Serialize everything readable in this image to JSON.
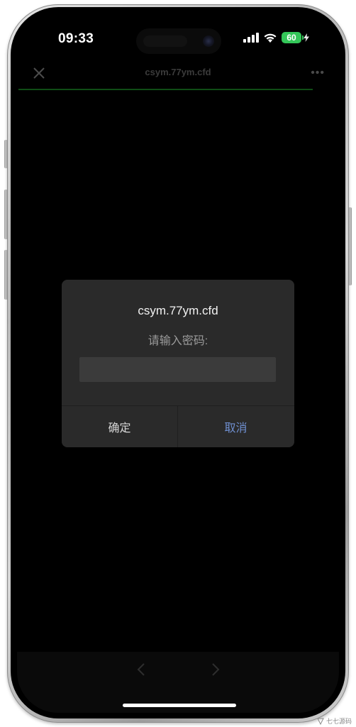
{
  "status_bar": {
    "time": "09:33",
    "battery": "60",
    "icons": [
      "signal-icon",
      "wifi-icon",
      "battery-icon",
      "bolt-icon"
    ]
  },
  "browser": {
    "title": "csym.77ym.cfd",
    "close_icon": "close-icon",
    "more_icon": "more-icon",
    "back_icon": "chevron-left-icon",
    "forward_icon": "chevron-right-icon",
    "progress_color": "#0f4d16"
  },
  "dialog": {
    "title": "csym.77ym.cfd",
    "message": "请输入密码:",
    "input_value": "",
    "ok_label": "确定",
    "cancel_label": "取消",
    "cancel_color": "#6f8fd0"
  },
  "watermark": {
    "text": "七七源码"
  }
}
